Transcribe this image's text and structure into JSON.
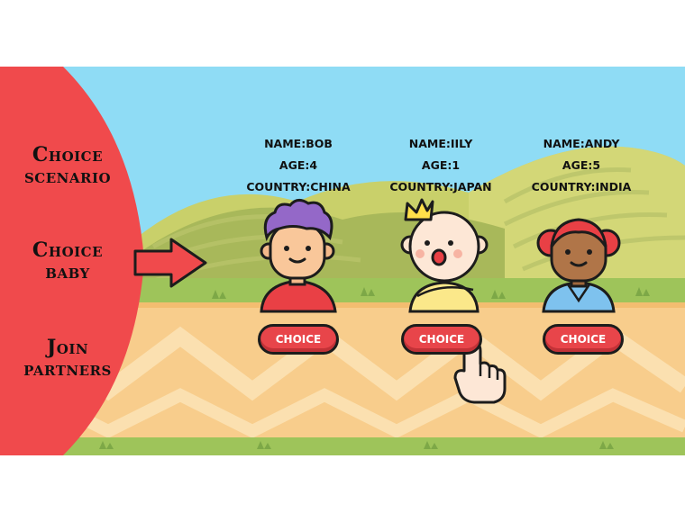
{
  "menu": {
    "items": [
      {
        "line1": "Choice",
        "line2": "scenario"
      },
      {
        "line1": "Choice",
        "line2": "baby"
      },
      {
        "line1": "Join",
        "line2": "partners"
      }
    ]
  },
  "babies": [
    {
      "name_label": "NAME:",
      "name": "BOB",
      "age_label": "AGE:",
      "age": "4",
      "country_label": "COUNTRY:",
      "country": "CHINA",
      "button": "CHOICE"
    },
    {
      "name_label": "NAME:",
      "name": "IILY",
      "age_label": "AGE:",
      "age": "1",
      "country_label": "COUNTRY:",
      "country": "JAPAN",
      "button": "CHOICE"
    },
    {
      "name_label": "NAME:",
      "name": "ANDY",
      "age_label": "AGE:",
      "age": "5",
      "country_label": "COUNTRY:",
      "country": "INDIA",
      "button": "CHOICE"
    }
  ],
  "colors": {
    "sky": "#8fdcf5",
    "hill_dark": "#a8b85a",
    "hill_light": "#c9d06a",
    "grass": "#9ec45a",
    "ground": "#f8cd8c",
    "ground_stripe": "#fbe0b0",
    "menu_red": "#f04a4c",
    "button_red": "#e8454a"
  },
  "icons": [
    "arrow-right-icon",
    "pointing-hand-icon"
  ]
}
